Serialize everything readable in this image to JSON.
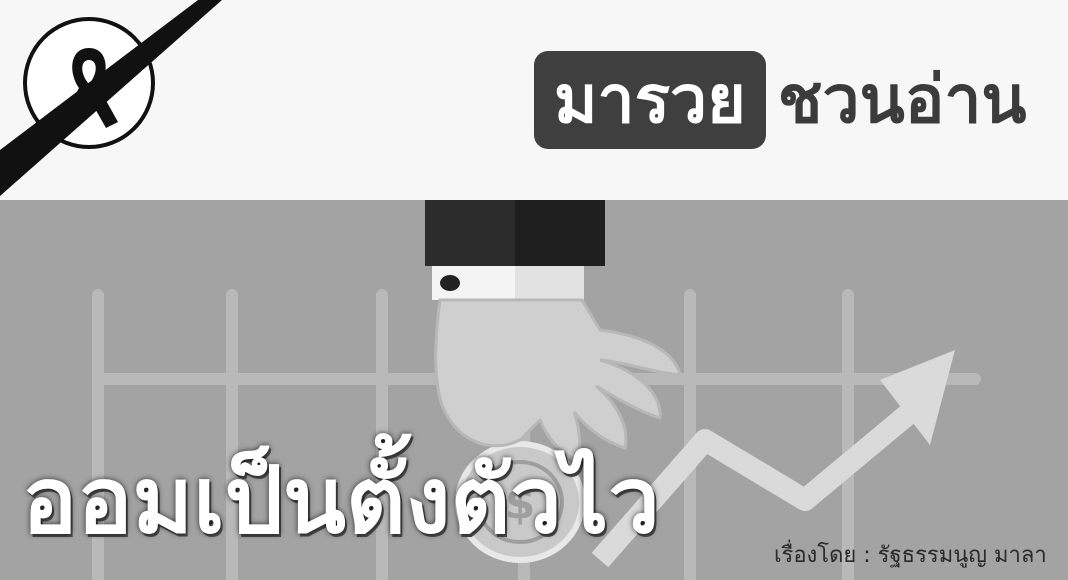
{
  "header": {
    "brand_highlight": "มารวย",
    "brand_rest": "ชวนอ่าน"
  },
  "article": {
    "title": "ออมเป็นตั้งตัวไว",
    "byline": "เรื่องโดย : รัฐธรรมนูญ มาลา"
  },
  "icons": {
    "mourning": "black-ribbon-icon",
    "coin": "dollar-coin-icon",
    "trend": "upward-trend-arrow-icon"
  },
  "colors": {
    "top_background": "#f7f7f7",
    "bottom_background": "#a3a3a3",
    "brand_box": "#3f3f3f",
    "ribbon": "#111111"
  }
}
